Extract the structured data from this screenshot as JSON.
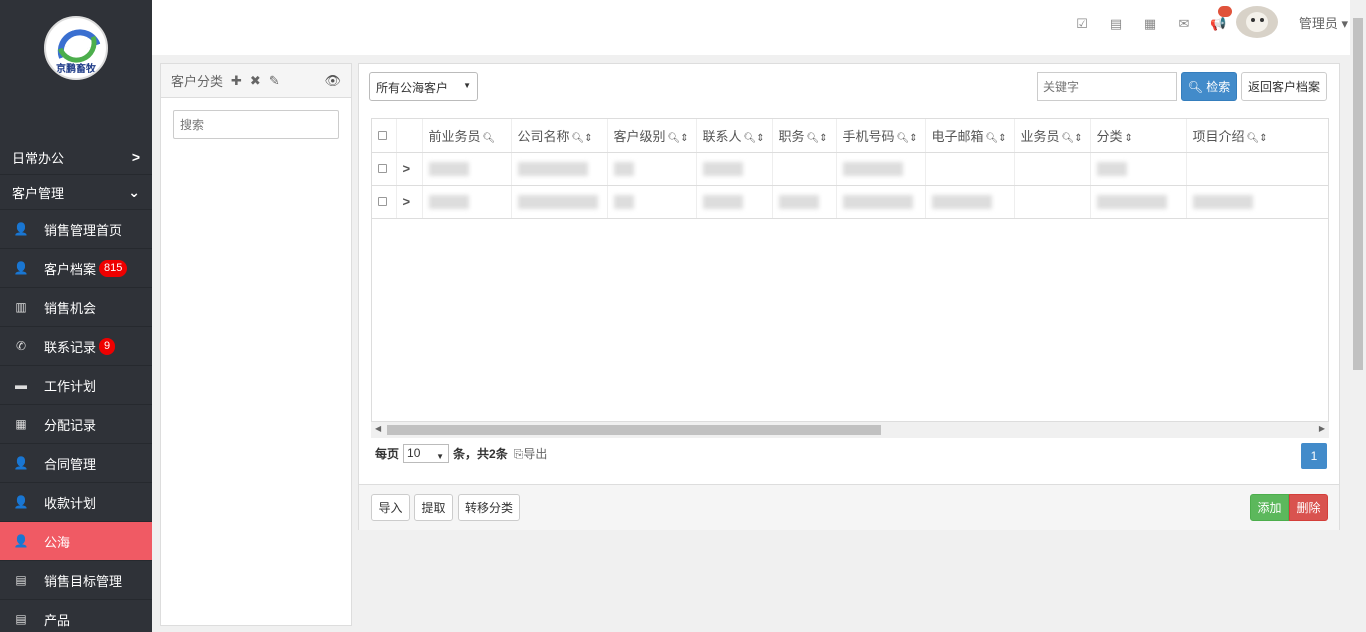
{
  "logo": {
    "text": "京鹏畜牧"
  },
  "sidebar": {
    "groups": [
      {
        "label": "日常办公",
        "chevron": "›"
      },
      {
        "label": "客户管理",
        "chevron": "⌄"
      }
    ],
    "items": [
      {
        "label": "销售管理首页",
        "icon": "user-icon",
        "glyph": "👤"
      },
      {
        "label": "客户档案",
        "icon": "user-icon",
        "glyph": "👤",
        "badge": "815"
      },
      {
        "label": "销售机会",
        "icon": "bar-chart-icon",
        "glyph": "▥"
      },
      {
        "label": "联系记录",
        "icon": "phone-icon",
        "glyph": "✆",
        "badge": "9"
      },
      {
        "label": "工作计划",
        "icon": "card-icon",
        "glyph": "▬"
      },
      {
        "label": "分配记录",
        "icon": "grid-icon",
        "glyph": "▦"
      },
      {
        "label": "合同管理",
        "icon": "user-icon",
        "glyph": "👤"
      },
      {
        "label": "收款计划",
        "icon": "user-icon",
        "glyph": "👤"
      },
      {
        "label": "公海",
        "icon": "user-icon",
        "glyph": "👤",
        "active": true
      },
      {
        "label": "销售目标管理",
        "icon": "list-icon",
        "glyph": "▤"
      },
      {
        "label": "产品",
        "icon": "list-icon",
        "glyph": "▤"
      }
    ],
    "accent": "#f05a64"
  },
  "header": {
    "icons": [
      "checkbox-icon",
      "list-card-icon",
      "server-icon",
      "mail-icon",
      "megaphone-icon"
    ],
    "user": "管理员 ▾"
  },
  "left_panel": {
    "title": "客户分类",
    "actions": {
      "add": "✚",
      "delete": "✖",
      "edit": "✎",
      "toggle": "👁"
    },
    "search_placeholder": "搜索"
  },
  "toolbar": {
    "filter_selected": "所有公海客户",
    "keyword_placeholder": "关键字",
    "search_label": "检索",
    "return_label": "返回客户档案"
  },
  "table": {
    "columns": [
      "前业务员",
      "公司名称",
      "客户级别",
      "联系人",
      "职务",
      "手机号码",
      "电子邮箱",
      "业务员",
      "分类",
      "项目介绍"
    ]
  },
  "pager": {
    "per_page_label": "每页",
    "per_page_value": "10",
    "summary_prefix": "条，共",
    "total": "2条",
    "export_label": "导出",
    "current_page": "1"
  },
  "footer": {
    "import_label": "导入",
    "extract_label": "提取",
    "move_label": "转移分类",
    "add_label": "添加",
    "delete_label": "删除"
  }
}
